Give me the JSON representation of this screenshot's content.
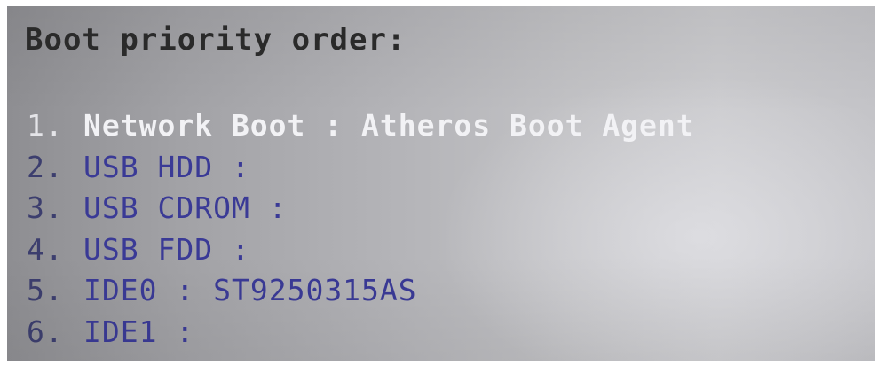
{
  "screen": {
    "title": "Boot priority order:"
  },
  "boot_items": [
    {
      "number": "1.",
      "device": "Network Boot",
      "separator": ":",
      "value": "Atheros Boot Agent",
      "selected": true
    },
    {
      "number": "2.",
      "device": "USB HDD",
      "separator": ":",
      "value": "",
      "selected": false
    },
    {
      "number": "3.",
      "device": "USB CDROM",
      "separator": ":",
      "value": "",
      "selected": false
    },
    {
      "number": "4.",
      "device": "USB FDD",
      "separator": ":",
      "value": "",
      "selected": false
    },
    {
      "number": "5.",
      "device": "IDE0",
      "separator": ":",
      "value": "ST9250315AS",
      "selected": false
    },
    {
      "number": "6.",
      "device": "IDE1",
      "separator": ":",
      "value": "",
      "selected": false
    }
  ],
  "colors": {
    "selected_text": "#f2f2f5",
    "item_text": "#3a3a96",
    "title_text": "#2c2c2c",
    "background": "#b4b4b8"
  }
}
